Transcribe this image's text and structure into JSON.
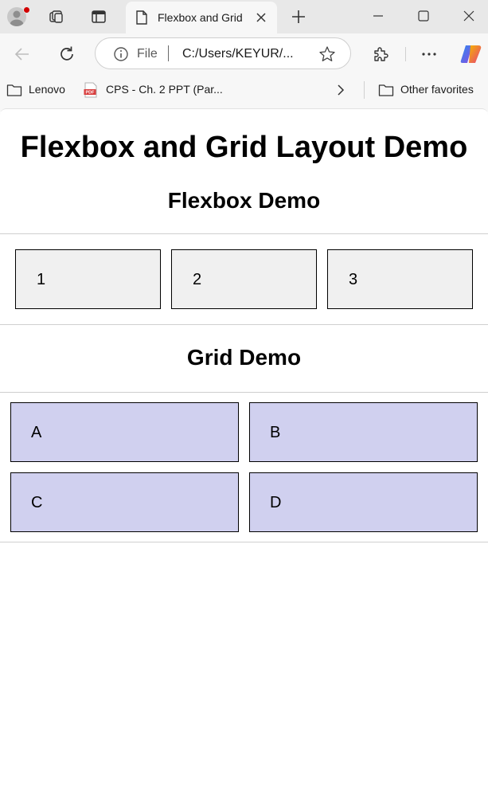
{
  "browser": {
    "tab_title": "Flexbox and Grid",
    "address_scheme": "File",
    "address_url": "C:/Users/KEYUR/...",
    "bookmarks": [
      {
        "label": "Lenovo",
        "icon": "folder-icon"
      },
      {
        "label": "CPS - Ch. 2 PPT (Par...",
        "icon": "pdf-icon"
      }
    ],
    "other_favorites": "Other favorites",
    "colors": {
      "tabbar": "#e8e8e8",
      "toolbar": "#f7f7f7",
      "profile_badge": "#d20000"
    }
  },
  "page": {
    "title": "Flexbox and Grid Layout Demo",
    "flex_section": {
      "heading": "Flexbox Demo",
      "items": [
        "1",
        "2",
        "3"
      ],
      "item_bg": "#f0f0f0"
    },
    "grid_section": {
      "heading": "Grid Demo",
      "items": [
        "A",
        "B",
        "C",
        "D"
      ],
      "item_bg": "#d0d0ef"
    }
  }
}
